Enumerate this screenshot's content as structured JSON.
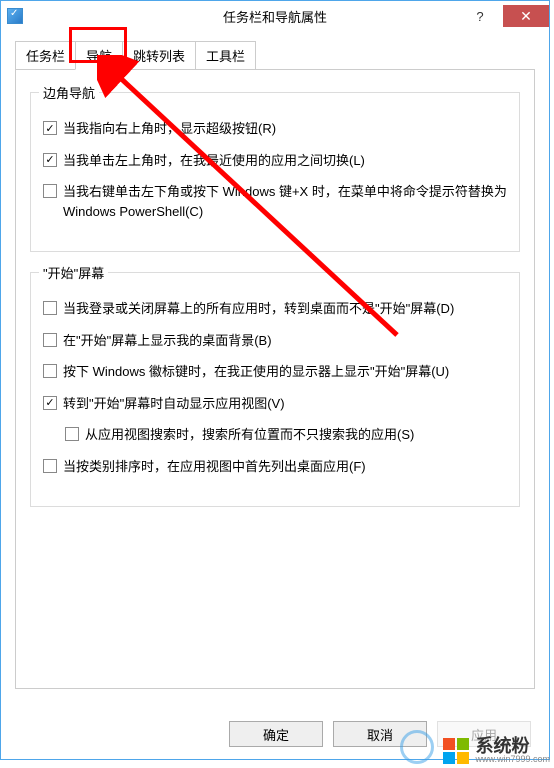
{
  "window": {
    "title": "任务栏和导航属性"
  },
  "tabs": {
    "items": [
      {
        "label": "任务栏"
      },
      {
        "label": "导航"
      },
      {
        "label": "跳转列表"
      },
      {
        "label": "工具栏"
      }
    ],
    "activeIndex": 1
  },
  "groups": {
    "corner": {
      "legend": "边角导航",
      "options": [
        {
          "label": "当我指向右上角时，显示超级按钮(R)",
          "checked": true
        },
        {
          "label": "当我单击左上角时，在我最近使用的应用之间切换(L)",
          "checked": true
        },
        {
          "label": "当我右键单击左下角或按下 Windows 键+X 时，在菜单中将命令提示符替换为 Windows PowerShell(C)",
          "checked": false
        }
      ]
    },
    "start": {
      "legend": "\"开始\"屏幕",
      "options": [
        {
          "label": "当我登录或关闭屏幕上的所有应用时，转到桌面而不是\"开始\"屏幕(D)",
          "checked": false
        },
        {
          "label": "在\"开始\"屏幕上显示我的桌面背景(B)",
          "checked": false
        },
        {
          "label": "按下 Windows 徽标键时，在我正使用的显示器上显示\"开始\"屏幕(U)",
          "checked": false
        },
        {
          "label": "转到\"开始\"屏幕时自动显示应用视图(V)",
          "checked": true
        },
        {
          "label": "从应用视图搜索时，搜索所有位置而不只搜索我的应用(S)",
          "checked": false,
          "indent": true
        },
        {
          "label": "当按类别排序时，在应用视图中首先列出桌面应用(F)",
          "checked": false
        }
      ]
    }
  },
  "buttons": {
    "ok": "确定",
    "cancel": "取消",
    "apply": "应用"
  },
  "watermark": {
    "text": "系统粉",
    "url": "www.win7999.com"
  }
}
